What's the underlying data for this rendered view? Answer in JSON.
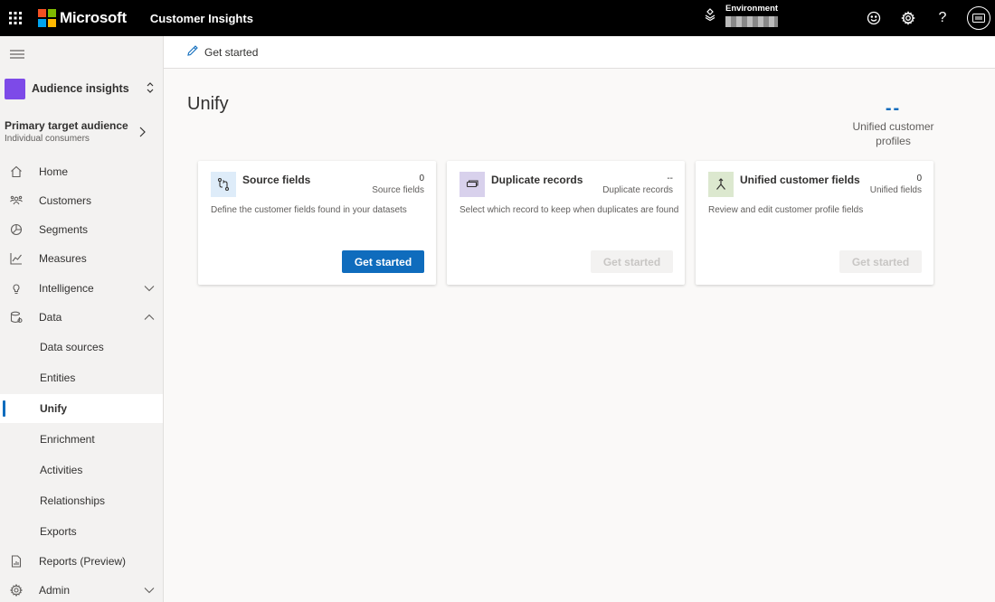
{
  "topbar": {
    "brand": "Microsoft",
    "app_title": "Customer Insights",
    "environment_label": "Environment",
    "icons": [
      "waffle-icon",
      "environment-icon",
      "smiley-icon",
      "gear-icon",
      "help-icon",
      "avatar"
    ]
  },
  "sidebar": {
    "audience_switch": "Audience insights",
    "target": {
      "title": "Primary target audience",
      "subtitle": "Individual consumers"
    },
    "items": [
      {
        "label": "Home",
        "icon": "home-icon"
      },
      {
        "label": "Customers",
        "icon": "customers-icon"
      },
      {
        "label": "Segments",
        "icon": "segments-icon"
      },
      {
        "label": "Measures",
        "icon": "measures-icon"
      },
      {
        "label": "Intelligence",
        "icon": "lightbulb-icon"
      },
      {
        "label": "Data",
        "icon": "data-icon"
      },
      {
        "label": "Data sources"
      },
      {
        "label": "Entities"
      },
      {
        "label": "Unify",
        "selected": true
      },
      {
        "label": "Enrichment"
      },
      {
        "label": "Activities"
      },
      {
        "label": "Relationships"
      },
      {
        "label": "Exports"
      },
      {
        "label": "Reports (Preview)",
        "icon": "reports-icon"
      },
      {
        "label": "Admin",
        "icon": "admin-gear-icon"
      }
    ]
  },
  "command_bar": {
    "get_started": "Get started"
  },
  "main": {
    "title": "Unify",
    "stat": {
      "value": "--",
      "label": "Unified customer profiles"
    },
    "cards": [
      {
        "title": "Source fields",
        "count": "0",
        "count_label": "Source fields",
        "description": "Define the customer fields found in your datasets",
        "button": "Get started",
        "button_enabled": true,
        "icon_bg": "#deecf9"
      },
      {
        "title": "Duplicate records",
        "count": "--",
        "count_label": "Duplicate records",
        "description": "Select which record to keep when duplicates are found",
        "button": "Get started",
        "button_enabled": false,
        "icon_bg": "#d8d1ec"
      },
      {
        "title": "Unified customer fields",
        "count": "0",
        "count_label": "Unified fields",
        "description": "Review and edit customer profile fields",
        "button": "Get started",
        "button_enabled": false,
        "icon_bg": "#dce8cf"
      }
    ]
  },
  "colors": {
    "accent": "#0f6cbd",
    "audience": "#7d4ae8",
    "topbar": "#000000"
  }
}
